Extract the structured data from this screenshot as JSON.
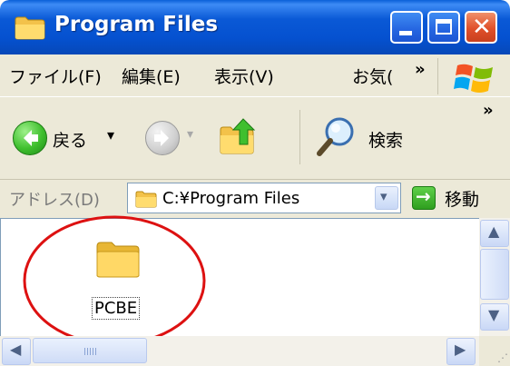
{
  "window": {
    "title": "Program Files",
    "controls": {
      "minimize": "minimize",
      "maximize": "maximize",
      "close": "✕"
    }
  },
  "menubar": {
    "items": [
      "ファイル(F)",
      "編集(E)",
      "表示(V)",
      "お気("
    ],
    "overflow": "»"
  },
  "toolbar": {
    "back_label": "戻る",
    "back_dropdown": "▾",
    "forward_dropdown": "▾",
    "search_label": "検索",
    "overflow": "»"
  },
  "address": {
    "label": "アドレス(D)",
    "value": "C:¥Program Files",
    "dropdown": "▾",
    "go_icon": "→",
    "go_label": "移動"
  },
  "content": {
    "items": [
      {
        "name": "PCBE",
        "icon": "folder-icon"
      }
    ],
    "annotation_color": "#dd1111"
  },
  "scrollbars": {
    "up": "▲",
    "down": "▼",
    "left": "◀",
    "right": "▶",
    "grip": "⋰"
  }
}
